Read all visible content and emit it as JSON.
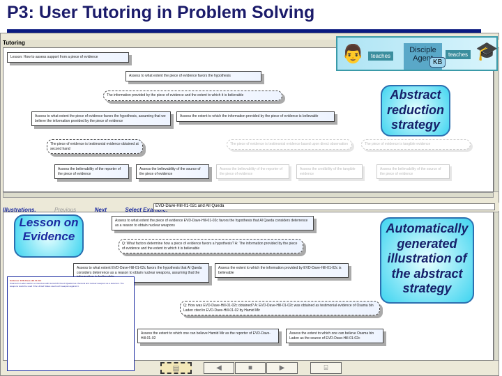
{
  "slide": {
    "title": "P3: User Tutoring in Problem Solving"
  },
  "window": {
    "panel_title": "Tutoring"
  },
  "banner": {
    "teaches_left": "teaches",
    "agent_line1": "Disciple",
    "agent_line2": "Agent",
    "kb": "KB",
    "teaches_right": "teaches"
  },
  "callouts": {
    "abstract": "Abstract reduction strategy",
    "lesson": "Lesson on Evidence",
    "illustration": "Automatically generated illustration of the abstract strategy"
  },
  "strategy": {
    "lesson": "Lesson: How to assess support from a piece of evidence",
    "root": "Assess to what extent the piece of evidence favors the hypothesis",
    "q1": "The information provided by the piece of evidence and the extent to which it is believable",
    "left": "Assess to what extent the piece of evidence favors the hypothesis, assuming that we believe the information provided by the piece of evidence",
    "right": "Assess the extent to which the information provided by the piece of evidence is believable",
    "o1": "The piece of evidence is testimonial evidence obtained at second hand",
    "o2": "The piece of evidence is testimonial evidence based upon direct observation",
    "o3": "The piece of evidence is tangible evidence",
    "leaves": [
      "Assess the believability of the reporter of the piece of evidence",
      "Assess the believability of the source of the piece of evidence",
      "Assess the believability of the reporter of the piece of evidence",
      "Assess the credibility of the tangible evidence",
      "Assess the believability of the source of the piece of evidence"
    ]
  },
  "toolbar": {
    "illustrations": "Illustrations.",
    "previous": "Previous",
    "next": "Next",
    "select": "Select Example:",
    "example": "EVD-Dave-Hill-01-02c and All Queda"
  },
  "example": {
    "root": "Assess to what extent the piece of evidence EVD-Dave-Hill-01-02c favors the hypothesis that Al Qaeda considers deterrence as a reason to obtain nuclear weapons",
    "q1": "Q: What factors determine how a piece of evidence favors a hypothesis? A: The information provided by the piece of evidence and the extent to which it is believable",
    "left": "Assess to what extent EVD-Dave-Hill-01-02c favors the hypothesis that Al Qaeda considers deterrence as a reason to obtain nuclear weapons, assuming that the information is believable",
    "right": "Assess the extent to which the information provided by EVD-Dave-Hill-01-02c is believable",
    "q2": "Q: How was EVD-Dave-Hill-01-02c obtained? A: EVD-Dave-Hill-01-02c was obtained as testimonial evidence of Osama bin Laden cited in EVD-Dave-Hill-01-02 by Hamid Mir",
    "leaf1": "Assess the extent to which one can believe Hamid Mir as the reporter of EVD-Dave-Hill-01-02",
    "leaf2": "Assess the extent to which one can believe Osama bin Laden as the source of EVD-Dave-Hill-01-02c",
    "doc_heading": "Evidence: EVD-Dave-Hill-01-02c",
    "doc_text": "Osama bin Laden said in an interview with Hamid Mir that Al Qaeda has chemical and nuclear weapons as a deterrent. The weapons would be used if the United States used such weapons against it."
  },
  "colors": {
    "accent": "#1a2aa0",
    "title": "#1b1b6a",
    "bubble": "#3fd4f0"
  }
}
